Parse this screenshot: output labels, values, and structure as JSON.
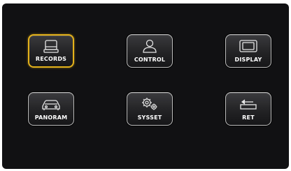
{
  "menu": {
    "items": [
      {
        "label": "RECORDS",
        "icon": "hard-drive-icon",
        "selected": true
      },
      {
        "label": "CONTROL",
        "icon": "user-icon",
        "selected": false
      },
      {
        "label": "DISPLAY",
        "icon": "monitor-icon",
        "selected": false
      },
      {
        "label": "PANORAM",
        "icon": "car-icon",
        "selected": false
      },
      {
        "label": "SYSSET",
        "icon": "gears-icon",
        "selected": false
      },
      {
        "label": "RET",
        "icon": "return-arrow-icon",
        "selected": false
      }
    ]
  },
  "colors": {
    "background": "#111113",
    "selected_border": "#e4b21b",
    "tile_border": "#bdbdbd",
    "label": "#ffffff"
  }
}
